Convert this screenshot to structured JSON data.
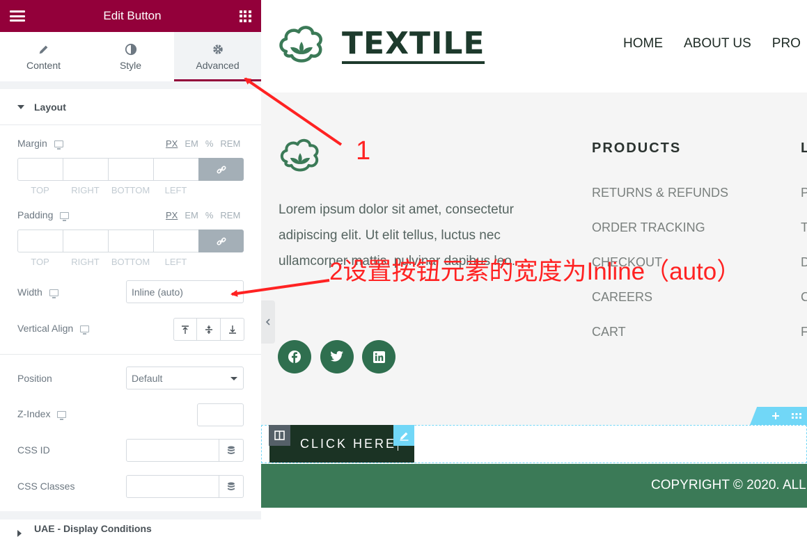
{
  "panel": {
    "title": "Edit Button",
    "tabs": [
      {
        "label": "Content",
        "icon": "pencil-icon"
      },
      {
        "label": "Style",
        "icon": "contrast-icon"
      },
      {
        "label": "Advanced",
        "icon": "gear-icon",
        "active": true
      }
    ],
    "layout_section": "Layout",
    "margin_label": "Margin",
    "padding_label": "Padding",
    "units": [
      "PX",
      "EM",
      "%",
      "REM"
    ],
    "dimension_labels": [
      "TOP",
      "RIGHT",
      "BOTTOM",
      "LEFT"
    ],
    "width_label": "Width",
    "width_value": "Inline (auto)",
    "valign_label": "Vertical Align",
    "position_label": "Position",
    "position_value": "Default",
    "zindex_label": "Z-Index",
    "cssid_label": "CSS ID",
    "cssclasses_label": "CSS Classes",
    "uae_section": "UAE - Display Conditions"
  },
  "site": {
    "logo_text": "TEXTILE",
    "nav": [
      "HOME",
      "ABOUT US",
      "PRO"
    ],
    "footer_text": "Lorem ipsum dolor sit amet, consectetur adipiscing elit. Ut elit tellus, luctus nec ullamcorper mattis, pulvinar dapibus leo.",
    "products_title": "PRODUCTS",
    "products_links": [
      "RETURNS & REFUNDS",
      "ORDER TRACKING",
      "CHECKOUT",
      "CAREERS",
      "CART"
    ],
    "second_col_title": "L",
    "second_col_links": [
      "P",
      "T",
      "D",
      "C",
      "F"
    ],
    "button_text": "CLICK HERE",
    "copyright": "COPYRIGHT © 2020. ALL"
  },
  "annotations": {
    "label_1": "1",
    "label_2": "2设置按钮元素的宽度为Inline（auto）"
  },
  "colors": {
    "panel_header": "#93003a",
    "brand_green": "#1d3a2c",
    "footer_bar": "#3b7a57",
    "annotation_red": "#ff2222",
    "edit_handle": "#71d7f7"
  }
}
